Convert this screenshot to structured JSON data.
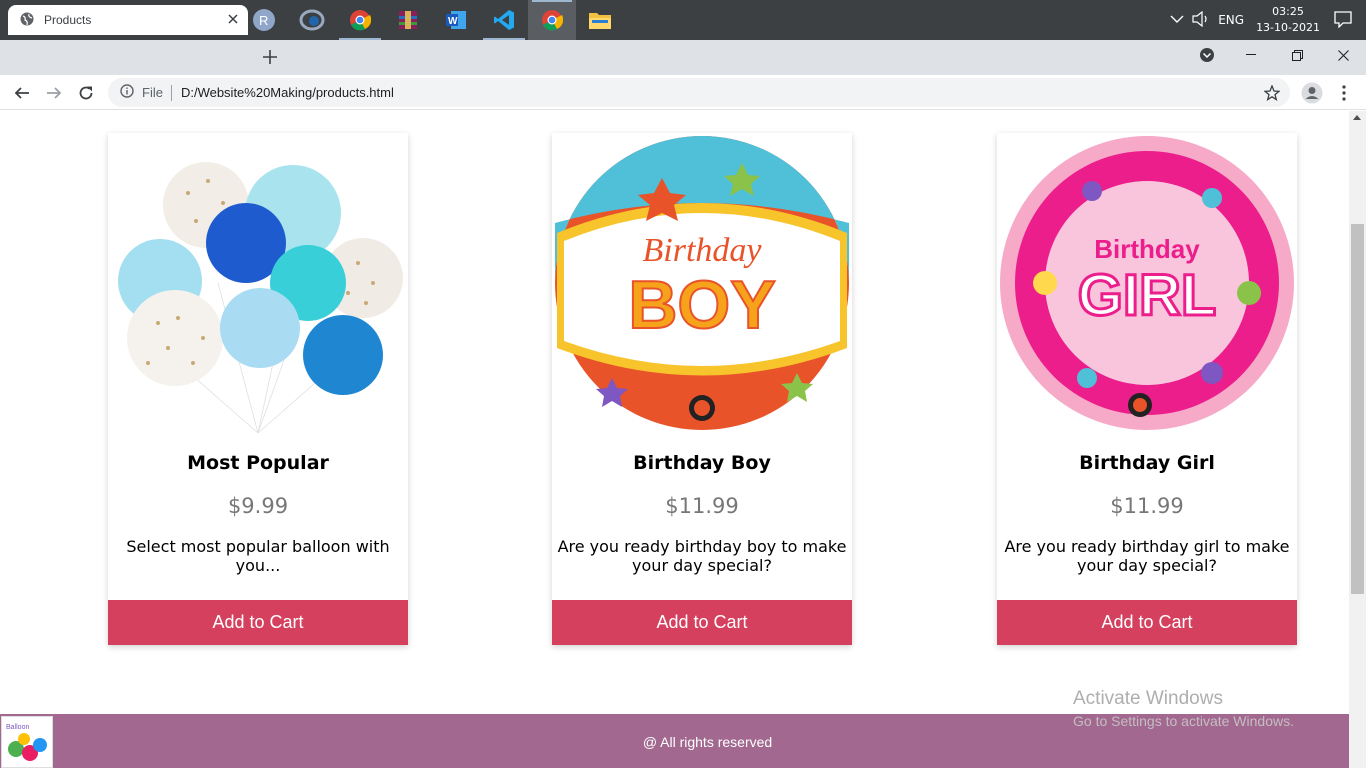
{
  "taskbar": {
    "apps": [
      "start-icon",
      "search-icon",
      "task-view-icon",
      "store-icon",
      "mail-icon",
      "r-icon",
      "rstudio-icon",
      "chrome-icon",
      "winrar-icon",
      "word-icon",
      "vscode-icon",
      "chrome-icon",
      "file-explorer-icon"
    ],
    "lang": "ENG",
    "time": "03:25",
    "date": "13-10-2021"
  },
  "browser": {
    "tab_title": "Products",
    "scheme_label": "File",
    "url": "D:/Website%20Making/products.html"
  },
  "products": [
    {
      "title": "Most Popular",
      "price": "$9.99",
      "desc": "Select most popular balloon with you...",
      "button": "Add to Cart"
    },
    {
      "title": "Birthday Boy",
      "price": "$11.99",
      "desc": "Are you ready birthday boy to make your day special?",
      "button": "Add to Cart"
    },
    {
      "title": "Birthday Girl",
      "price": "$11.99",
      "desc": "Are you ready birthday girl to make your day special?",
      "button": "Add to Cart"
    }
  ],
  "footer": {
    "text": "@ All rights reserved"
  },
  "watermark": {
    "line1": "Activate Windows",
    "line2": "Go to Settings to activate Windows."
  },
  "colors": {
    "button": "#d4405e",
    "footer": "#a2688f",
    "taskbar": "#3c4043"
  }
}
